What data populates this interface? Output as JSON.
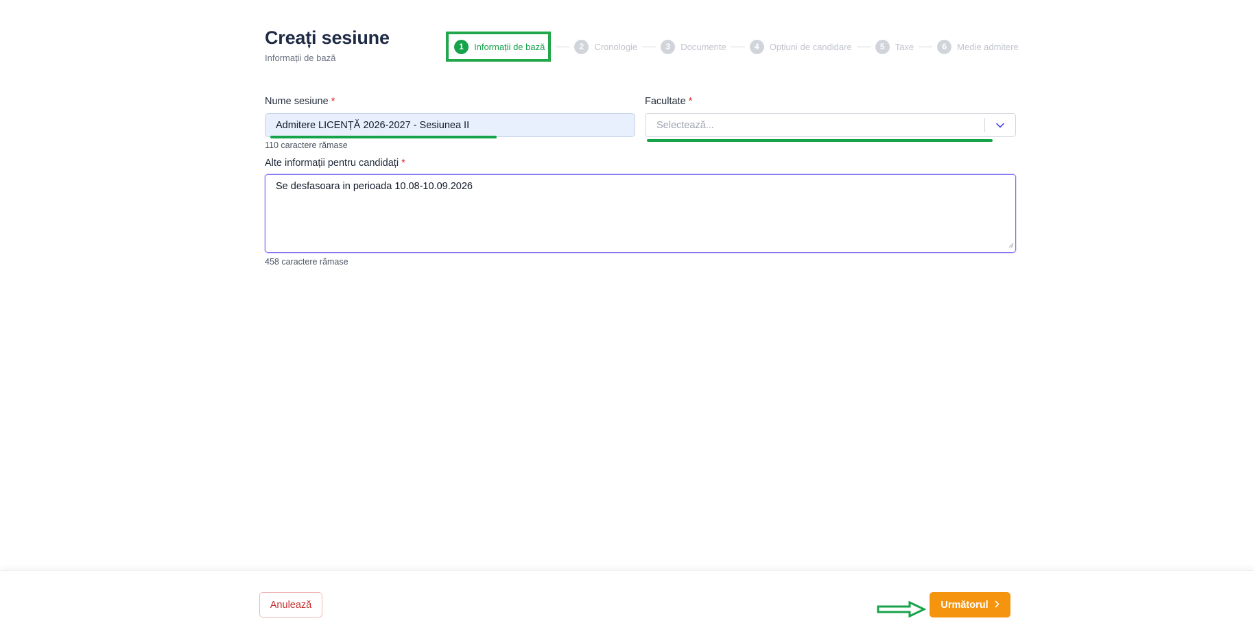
{
  "header": {
    "title": "Creați sesiune",
    "subtitle": "Informații de bază"
  },
  "stepper": {
    "steps": [
      {
        "num": "1",
        "label": "Informații de bază",
        "active": true
      },
      {
        "num": "2",
        "label": "Cronologie",
        "active": false
      },
      {
        "num": "3",
        "label": "Documente",
        "active": false
      },
      {
        "num": "4",
        "label": "Opțiuni de candidare",
        "active": false
      },
      {
        "num": "5",
        "label": "Taxe",
        "active": false
      },
      {
        "num": "6",
        "label": "Medie admitere",
        "active": false
      }
    ]
  },
  "form": {
    "session_name": {
      "label": "Nume sesiune",
      "required_mark": "*",
      "value": "Admitere LICENȚĂ 2026-2027 - Sesiunea II",
      "hint": "110 caractere rămase"
    },
    "faculty": {
      "label": "Facultate",
      "required_mark": "*",
      "placeholder": "Selectează..."
    },
    "other_info": {
      "label": "Alte informații pentru candidați",
      "required_mark": "*",
      "value": "Se desfasoara in perioada 10.08-10.09.2026",
      "hint": "458 caractere rămase"
    }
  },
  "footer": {
    "cancel_label": "Anulează",
    "next_label": "Următorul"
  },
  "colors": {
    "accent_green": "#16a34a",
    "primary_orange": "#f5940f",
    "danger_red": "#c53030",
    "focus_purple": "#7c6cf0"
  },
  "icons": {
    "select_toggle": "chevron-down-icon",
    "next": "chevron-right-icon",
    "annotation": "arrow-right-icon"
  }
}
